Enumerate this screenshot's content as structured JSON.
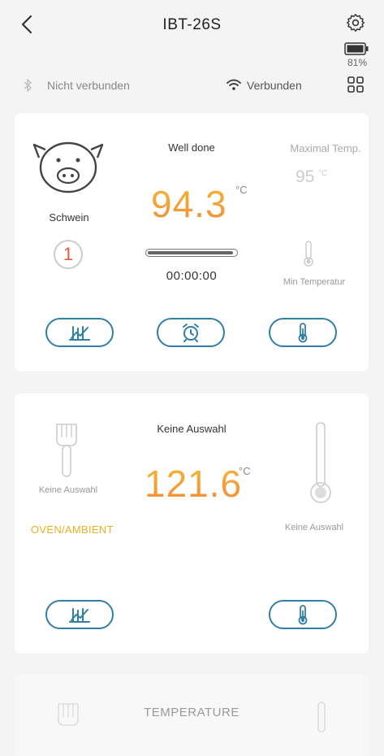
{
  "header": {
    "title": "IBT-26S",
    "battery_percent": "81%"
  },
  "connection": {
    "bluetooth_label": "Nicht verbunden",
    "wifi_label": "Verbunden"
  },
  "probe1": {
    "animal": "Schwein",
    "probe_number": "1",
    "doneness": "Well done",
    "temperature": "94.3",
    "unit": "°C",
    "progress": 0.97,
    "timer": "00:00:00",
    "max_label": "Maximal Temp.",
    "max_value": "95",
    "max_unit": "°C",
    "min_label": "Min Temperatur"
  },
  "probe2": {
    "left_label": "Keine Auswahl",
    "mode_label": "OVEN/AMBIENT",
    "selection": "Keine Auswahl",
    "temperature": "121.6",
    "unit": "°C",
    "right_label": "Keine Auswahl"
  },
  "probe3": {
    "label": "TEMPERATURE"
  },
  "colors": {
    "accent_blue": "#2f7fa8",
    "temp_gradient_top": "#f7b734",
    "temp_gradient_bottom": "#f28b3a",
    "oven_label": "#e8b21e",
    "probe_number": "#e05a3a"
  },
  "icons": [
    "back-arrow-icon",
    "gear-icon",
    "battery-icon",
    "bluetooth-icon",
    "wifi-icon",
    "grid-icon",
    "pig-icon",
    "chart-icon",
    "alarm-clock-icon",
    "thermometer-icon",
    "brush-icon"
  ]
}
